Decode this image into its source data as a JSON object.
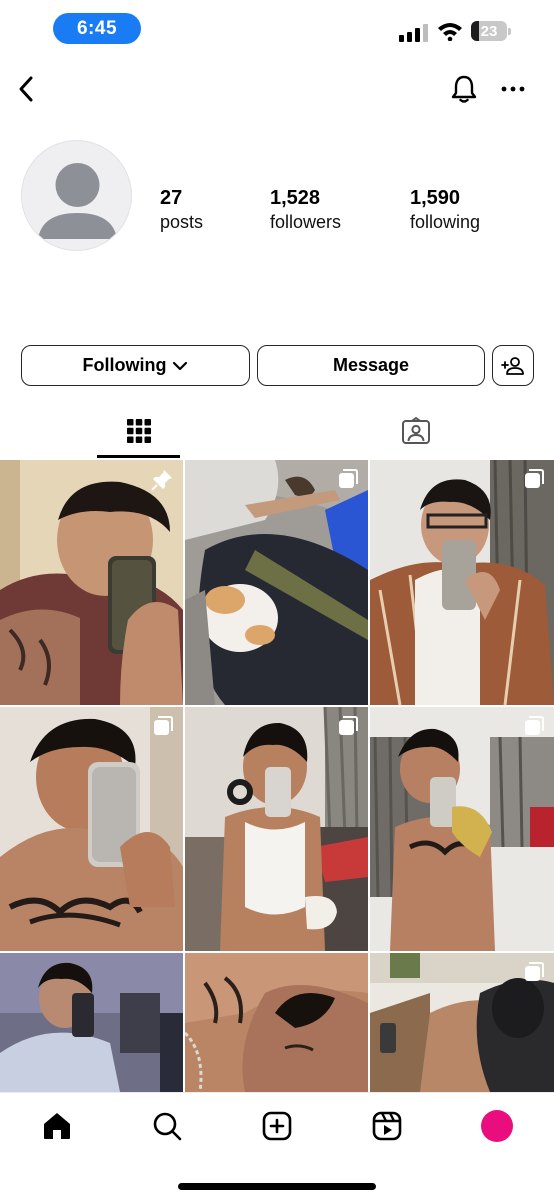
{
  "status_bar": {
    "time": "6:45",
    "battery": "23",
    "battery_level": 0.23
  },
  "header": {
    "back_icon": "chevron-left-icon",
    "bell_icon": "bell-icon",
    "more_icon": "ellipsis-icon"
  },
  "profile": {
    "stats": [
      {
        "value": "27",
        "label": "posts"
      },
      {
        "value": "1,528",
        "label": "followers"
      },
      {
        "value": "1,590",
        "label": "following"
      }
    ]
  },
  "actions": {
    "following_label": "Following",
    "message_label": "Message"
  },
  "tabs": [
    {
      "icon": "grid-icon",
      "active": true
    },
    {
      "icon": "tagged-icon",
      "active": false
    }
  ],
  "grid": {
    "posts": [
      {
        "badge": "pin-icon"
      },
      {
        "badge": "multi-photo-icon"
      },
      {
        "badge": "multi-photo-icon"
      },
      {
        "badge": "multi-photo-icon"
      },
      {
        "badge": "multi-photo-icon"
      },
      {
        "badge": "multi-photo-icon"
      },
      {
        "badge": ""
      },
      {
        "badge": ""
      },
      {
        "badge": "multi-photo-icon"
      }
    ]
  },
  "bottom_nav": [
    "home-icon",
    "search-icon",
    "create-icon",
    "reels-icon",
    "profile-icon"
  ],
  "colors": {
    "time_pill": "#1a7cf5",
    "profile_dot": "#ea0d7d"
  }
}
